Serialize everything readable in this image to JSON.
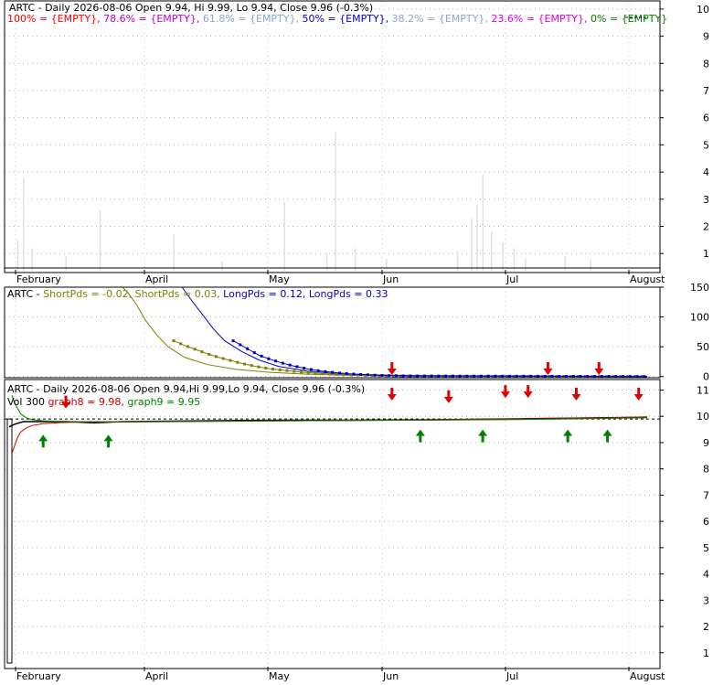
{
  "chart_data": [
    {
      "type": "bar",
      "panel": "fibonacci-volume",
      "title": "ARTC - Daily 2026-08-06 Open 9.94, Hi 9.99, Lo 9.94, Close 9.96 (-0.3%)",
      "legend": [
        {
          "label": "100% = {EMPTY},",
          "color": "#ff0000"
        },
        {
          "label": "78.6% = {EMPTY},",
          "color": "#c000c0"
        },
        {
          "label": "61.8% = {EMPTY},",
          "color": "#8da6c8"
        },
        {
          "label": "50% = {EMPTY},",
          "color": "#0000cc"
        },
        {
          "label": "38.2% = {EMPTY},",
          "color": "#8da6c8"
        },
        {
          "label": "23.6% = {EMPTY},",
          "color": "#e000e0"
        },
        {
          "label": "0% = {EMPTY}",
          "color": "#008000"
        }
      ],
      "y_tick_labels": [
        "1",
        "2",
        "3",
        "4",
        "5",
        "6",
        "7",
        "8",
        "9",
        "10"
      ],
      "ylim": [
        0.3,
        10.3
      ],
      "x_tick_labels": [
        "February",
        "April",
        "May",
        "Jun",
        "Jul",
        "August"
      ],
      "volume_bars": [
        {
          "day": 3,
          "value": 1.5
        },
        {
          "day": 5,
          "value": 3.8
        },
        {
          "day": 8,
          "value": 1.2
        },
        {
          "day": 20,
          "value": 0.9
        },
        {
          "day": 32,
          "value": 2.6
        },
        {
          "day": 58,
          "value": 1.7
        },
        {
          "day": 75,
          "value": 0.7
        },
        {
          "day": 97,
          "value": 2.9
        },
        {
          "day": 112,
          "value": 1.0
        },
        {
          "day": 115,
          "value": 5.5
        },
        {
          "day": 122,
          "value": 1.2
        },
        {
          "day": 133,
          "value": 0.8
        },
        {
          "day": 158,
          "value": 1.1
        },
        {
          "day": 163,
          "value": 2.3
        },
        {
          "day": 165,
          "value": 2.8
        },
        {
          "day": 167,
          "value": 3.9
        },
        {
          "day": 170,
          "value": 1.8
        },
        {
          "day": 174,
          "value": 1.4
        },
        {
          "day": 178,
          "value": 1.2
        },
        {
          "day": 182,
          "value": 0.8
        },
        {
          "day": 196,
          "value": 0.9
        },
        {
          "day": 205,
          "value": 0.8
        }
      ]
    },
    {
      "type": "line",
      "panel": "momentum",
      "legend": [
        {
          "label": "ARTC -",
          "color": "#000000"
        },
        {
          "label": "ShortPds = -0.02,",
          "color": "#808000"
        },
        {
          "label": "ShortPds = 0.03,",
          "color": "#808000"
        },
        {
          "label": "LongPds = 0.12,",
          "color": "#0000cc"
        },
        {
          "label": "LongPds = 0.33",
          "color": "#0000cc"
        }
      ],
      "y_tick_labels": [
        "0",
        "50",
        "100",
        "150"
      ],
      "ylim": [
        -2,
        150
      ],
      "series": [
        {
          "style": "line",
          "color": "#808000",
          "x": [
            40,
            42,
            45,
            48,
            52,
            56,
            62,
            70,
            80,
            92,
            105,
            120,
            140,
            225
          ],
          "y": [
            150,
            140,
            120,
            95,
            70,
            50,
            32,
            20,
            12,
            7,
            4,
            2,
            1,
            0
          ]
        },
        {
          "style": "line",
          "color": "#0000cc",
          "x": [
            61,
            64,
            68,
            72,
            76,
            82,
            88,
            95,
            105,
            118,
            135,
            160,
            225
          ],
          "y": [
            150,
            130,
            105,
            80,
            60,
            42,
            28,
            17,
            9,
            4,
            2,
            1,
            0
          ]
        },
        {
          "style": "dots",
          "color": "#808000",
          "x": [
            58,
            62,
            66,
            70,
            74,
            78,
            82,
            87,
            92,
            98,
            104,
            110,
            118,
            126,
            135,
            145,
            225
          ],
          "y": [
            60,
            52,
            45,
            38,
            32,
            27,
            22,
            17,
            13,
            10,
            7,
            5,
            3,
            2,
            1,
            0.5,
            0
          ]
        },
        {
          "style": "dots",
          "color": "#0000cc",
          "x": [
            79,
            82,
            85,
            88,
            92,
            96,
            100,
            105,
            110,
            116,
            122,
            130,
            140,
            225
          ],
          "y": [
            60,
            52,
            44,
            36,
            29,
            23,
            18,
            13,
            9,
            6,
            4,
            2,
            1,
            0
          ]
        }
      ],
      "down_arrows_day": [
        135,
        190,
        208
      ]
    },
    {
      "type": "line",
      "panel": "price",
      "title": "ARTC - Daily 2026-08-06 Open 9.94,Hi 9.99,Lo 9.94, Close 9.96 (-0.3%)",
      "legend": [
        {
          "label": "Vol 300",
          "color": "#000000"
        },
        {
          "label": "graph8 = 9.98,",
          "color": "#cc0000"
        },
        {
          "label": "graph9 = 9.95",
          "color": "#008000"
        }
      ],
      "y_tick_labels": [
        "1",
        "2",
        "3",
        "4",
        "5",
        "6",
        "7",
        "8",
        "9",
        "10",
        "11"
      ],
      "ylim": [
        0.4,
        11.4
      ],
      "x_tick_labels": [
        "February",
        "April",
        "May",
        "Jun",
        "Jul",
        "August"
      ],
      "dashed_level": 9.9,
      "series": [
        {
          "name": "Close",
          "color": "#000000",
          "x": [
            0,
            2,
            5,
            10,
            15,
            20,
            30,
            40,
            60,
            80,
            100,
            120,
            135,
            160,
            175,
            190,
            200,
            210,
            225
          ],
          "y": [
            9.6,
            9.7,
            9.8,
            9.8,
            9.8,
            9.8,
            9.75,
            9.8,
            9.82,
            9.84,
            9.85,
            9.85,
            9.86,
            9.88,
            9.9,
            9.92,
            9.93,
            9.95,
            9.96
          ]
        },
        {
          "name": "graph8",
          "color": "#cc0000",
          "x": [
            1,
            2,
            3,
            4,
            6,
            8,
            12,
            18,
            25,
            40,
            60,
            100,
            140,
            180,
            210,
            225
          ],
          "y": [
            8.6,
            8.9,
            9.2,
            9.4,
            9.55,
            9.65,
            9.72,
            9.76,
            9.78,
            9.78,
            9.8,
            9.83,
            9.86,
            9.9,
            9.94,
            9.98
          ]
        },
        {
          "name": "graph9",
          "color": "#008000",
          "x": [
            1,
            2,
            3,
            4,
            6,
            8,
            12,
            18,
            25,
            40,
            60,
            100,
            140,
            180,
            210,
            225
          ],
          "y": [
            10.8,
            10.5,
            10.3,
            10.1,
            9.95,
            9.88,
            9.83,
            9.81,
            9.8,
            9.8,
            9.81,
            9.83,
            9.85,
            9.88,
            9.92,
            9.95
          ]
        }
      ],
      "volume_bar": {
        "day": 1,
        "value": 9.9
      },
      "down_arrows": [
        {
          "day": 20,
          "y": 10.3
        },
        {
          "day": 135,
          "y": 10.6
        },
        {
          "day": 155,
          "y": 10.5
        },
        {
          "day": 175,
          "y": 10.7
        },
        {
          "day": 183,
          "y": 10.7
        },
        {
          "day": 200,
          "y": 10.6
        },
        {
          "day": 222,
          "y": 10.6
        }
      ],
      "up_arrows": [
        {
          "day": 12,
          "y": 9.3
        },
        {
          "day": 35,
          "y": 9.3
        },
        {
          "day": 145,
          "y": 9.5
        },
        {
          "day": 167,
          "y": 9.5
        },
        {
          "day": 197,
          "y": 9.5
        },
        {
          "day": 211,
          "y": 9.5
        }
      ]
    }
  ]
}
